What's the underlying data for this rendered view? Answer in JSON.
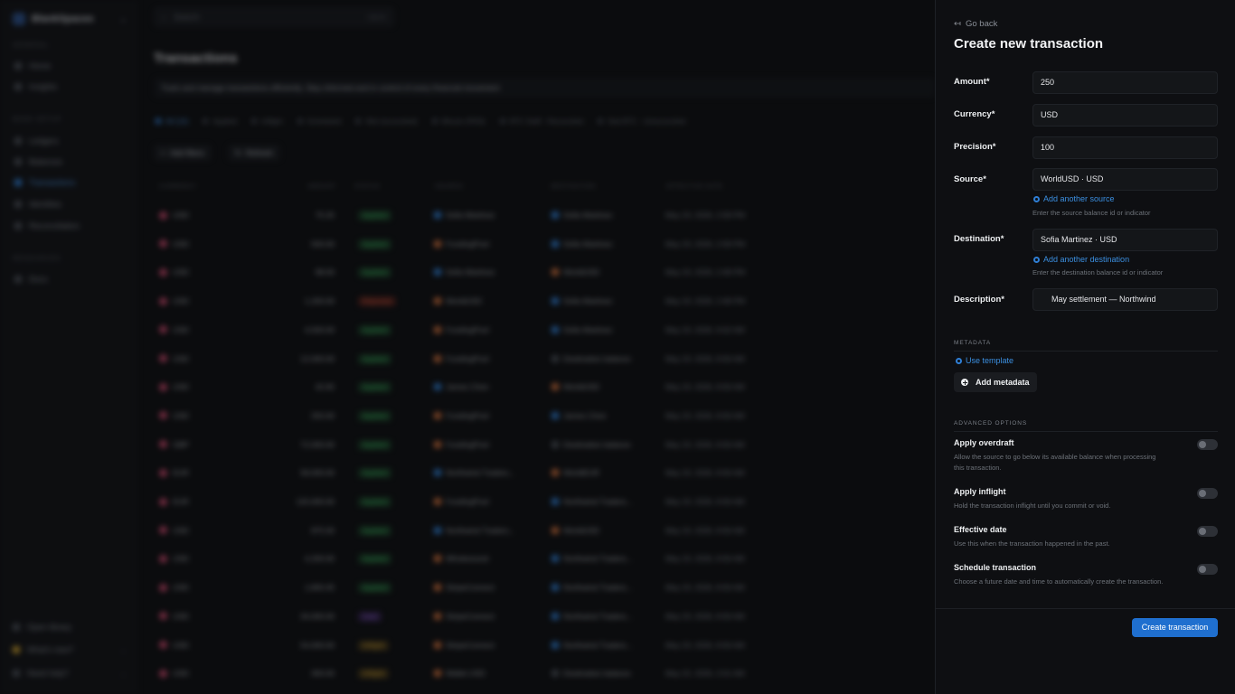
{
  "sidebar": {
    "workspace": "BlankSpaces",
    "sections": [
      {
        "label": "GENERAL",
        "items": [
          {
            "label": "Home"
          },
          {
            "label": "Insights"
          }
        ]
      },
      {
        "label": "BANK SETUP",
        "items": [
          {
            "label": "Ledgers"
          },
          {
            "label": "Balances"
          },
          {
            "label": "Transactions",
            "active": true
          },
          {
            "label": "Identities"
          },
          {
            "label": "Reconciliation"
          }
        ]
      },
      {
        "label": "RESOURCES",
        "items": [
          {
            "label": "Docs"
          }
        ]
      }
    ],
    "bottom": [
      {
        "label": "Open library"
      },
      {
        "label": "What's new?"
      },
      {
        "label": "Need help?"
      }
    ]
  },
  "search": {
    "placeholder": "Search",
    "shortcut": "Ctrl K"
  },
  "page": {
    "title": "Transactions",
    "banner": "Track and manage transactions efficiently. Stay informed and in control of every financial movement",
    "tabs": [
      "All (10)",
      "Applied",
      "Inflight",
      "Scheduled",
      "Skit (reconciled)",
      "Bitcoin (PEN)",
      "BTC Staff - Reconciled",
      "Stat BTC - Unreconciled"
    ],
    "buttons": {
      "filters": "Add filters",
      "refresh": "Refresh"
    },
    "columns": [
      "CURRENCY",
      "AMOUNT",
      "STATUS",
      "SOURCE",
      "DESTINATION",
      "EFFECTIVE DATE"
    ],
    "rows": [
      {
        "currency": "USD",
        "amount": "75.25",
        "status": "Applied",
        "status_kind": "ok",
        "source": "Sofia Martinez",
        "src_color": "blue",
        "destination": "Sofia Martinez",
        "dst_color": "blue",
        "date": "May 23, 2026, 2:58 PM"
      },
      {
        "currency": "USD",
        "amount": "500.00",
        "status": "Applied",
        "status_kind": "ok",
        "source": "FundingPool",
        "src_color": "orange",
        "destination": "Sofia Martinez",
        "dst_color": "blue",
        "date": "May 23, 2026, 2:58 PM"
      },
      {
        "currency": "USD",
        "amount": "98.00",
        "status": "Applied",
        "status_kind": "ok",
        "source": "Sofia Martinez",
        "src_color": "blue",
        "destination": "WorldUSD",
        "dst_color": "orange",
        "date": "May 23, 2026, 2:48 PM"
      },
      {
        "currency": "USD",
        "amount": "1,200.00",
        "status": "Rejected",
        "status_kind": "rej",
        "source": "WorldUSD",
        "src_color": "orange",
        "destination": "Sofia Martinez",
        "dst_color": "blue",
        "date": "May 23, 2026, 2:48 PM"
      },
      {
        "currency": "USD",
        "amount": "4,500.00",
        "status": "Applied",
        "status_kind": "ok",
        "source": "FundingPool",
        "src_color": "orange",
        "destination": "Sofia Martinez",
        "dst_color": "blue",
        "date": "May 23, 2026, 9:02 AM"
      },
      {
        "currency": "USD",
        "amount": "12,000.00",
        "status": "Applied",
        "status_kind": "ok",
        "source": "FundingPool",
        "src_color": "orange",
        "destination": "Destination balance",
        "dst_color": "gray",
        "date": "May 23, 2026, 8:56 AM"
      },
      {
        "currency": "USD",
        "amount": "42.65",
        "status": "Applied",
        "status_kind": "ok",
        "source": "James Chen",
        "src_color": "blue",
        "destination": "WorldUSD",
        "dst_color": "orange",
        "date": "May 23, 2026, 8:56 AM"
      },
      {
        "currency": "USD",
        "amount": "250.00",
        "status": "Applied",
        "status_kind": "ok",
        "source": "FundingPool",
        "src_color": "orange",
        "destination": "James Chen",
        "dst_color": "blue",
        "date": "May 23, 2026, 8:56 AM"
      },
      {
        "currency": "GBP",
        "amount": "72,000.00",
        "status": "Applied",
        "status_kind": "ok",
        "source": "FundingPool",
        "src_color": "orange",
        "destination": "Destination balance",
        "dst_color": "gray",
        "date": "May 23, 2026, 8:56 AM"
      },
      {
        "currency": "EUR",
        "amount": "58,000.00",
        "status": "Applied",
        "status_kind": "ok",
        "source": "Northwind Traders...",
        "src_color": "blue",
        "destination": "WorldEUR",
        "dst_color": "orange",
        "date": "May 23, 2026, 8:56 AM"
      },
      {
        "currency": "EUR",
        "amount": "120,000.00",
        "status": "Applied",
        "status_kind": "ok",
        "source": "FundingPool",
        "src_color": "orange",
        "destination": "Northwind Traders...",
        "dst_color": "blue",
        "date": "May 23, 2026, 8:56 AM"
      },
      {
        "currency": "USD",
        "amount": "875.00",
        "status": "Applied",
        "status_kind": "ok",
        "source": "Northwind Traders...",
        "src_color": "blue",
        "destination": "WorldUSD",
        "dst_color": "orange",
        "date": "May 23, 2026, 8:56 AM"
      },
      {
        "currency": "USD",
        "amount": "4,200.00",
        "status": "Applied",
        "status_kind": "ok",
        "source": "Wholesound",
        "src_color": "orange",
        "destination": "Northwind Traders...",
        "dst_color": "blue",
        "date": "May 23, 2026, 8:56 AM"
      },
      {
        "currency": "USD",
        "amount": "1,800.45",
        "status": "Applied",
        "status_kind": "ok",
        "source": "StripeConnect",
        "src_color": "orange",
        "destination": "Northwind Traders...",
        "dst_color": "blue",
        "date": "May 23, 2026, 8:56 AM"
      },
      {
        "currency": "USD",
        "amount": "34,000.00",
        "status": "Void",
        "status_kind": "vd",
        "source": "StripeConnect",
        "src_color": "orange",
        "destination": "Northwind Traders...",
        "dst_color": "blue",
        "date": "May 23, 2026, 8:56 AM"
      },
      {
        "currency": "USD",
        "amount": "54,000.00",
        "status": "Inflight",
        "status_kind": "fl",
        "source": "StripeConnect",
        "src_color": "orange",
        "destination": "Northwind Traders...",
        "dst_color": "blue",
        "date": "May 23, 2026, 8:56 AM"
      },
      {
        "currency": "USD",
        "amount": "300.00",
        "status": "Inflight",
        "status_kind": "fl",
        "source": "Wallet USD",
        "src_color": "orange",
        "destination": "Destination balance",
        "dst_color": "gray",
        "date": "May 22, 2026, 2:01 AM"
      }
    ]
  },
  "drawer": {
    "back": "Go back",
    "title": "Create new transaction",
    "fields": {
      "amount": {
        "label": "Amount*",
        "value": "250"
      },
      "currency": {
        "label": "Currency*",
        "value": "USD"
      },
      "precision": {
        "label": "Precision*",
        "value": "100"
      },
      "source": {
        "label": "Source*",
        "value": "WorldUSD · USD",
        "add": "Add another source",
        "hint": "Enter the source balance id or indicator"
      },
      "destination": {
        "label": "Destination*",
        "value": "Sofia Martinez · USD",
        "add": "Add another destination",
        "hint": "Enter the destination balance id or indicator"
      },
      "description": {
        "label": "Description*",
        "value": "May settlement — Northwind"
      }
    },
    "metadata": {
      "heading": "METADATA",
      "template": "Use template",
      "add": "Add metadata"
    },
    "advanced": {
      "heading": "ADVANCED OPTIONS",
      "options": [
        {
          "title": "Apply overdraft",
          "desc": "Allow the source to go below its available balance when processing this transaction.",
          "on": false
        },
        {
          "title": "Apply inflight",
          "desc": "Hold the transaction inflight until you commit or void.",
          "on": false
        },
        {
          "title": "Effective date",
          "desc": "Use this when the transaction happened in the past.",
          "on": false
        },
        {
          "title": "Schedule transaction",
          "desc": "Choose a future date and time to automatically create the transaction.",
          "on": false
        }
      ]
    },
    "submit": "Create transaction"
  },
  "colors": {
    "accent": "#1f6fcf",
    "link": "#3b8fe0",
    "background": "#0b0c0e",
    "panel": "#0e0f12"
  }
}
